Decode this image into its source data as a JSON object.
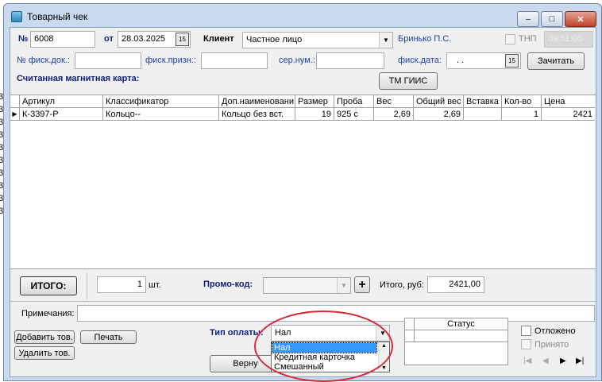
{
  "background_row_labels": [
    "3",
    "3",
    "3",
    "3",
    "3",
    "3",
    "3",
    "3",
    "3",
    "3"
  ],
  "window": {
    "title": "Товарный чек",
    "controls": {
      "minimize": "‒",
      "maximize": "□",
      "close": "✕"
    }
  },
  "header": {
    "number_label": "№",
    "number_value": "6008",
    "date_label": "от",
    "date_value": "28.03.2025",
    "calendar_button": "15",
    "client_label": "Клиент",
    "client_value": "Частное лицо",
    "client_person": "Бринько П.С.",
    "tnp_label": "ТНП",
    "tnp_value": "09:51:00",
    "fisc_doc_label": "№ фиск.док.:",
    "fisc_doc_value": "",
    "fisc_sign_label": "фиск.призн.:",
    "fisc_sign_value": "",
    "serial_label": "сер.нум.:",
    "serial_value": "",
    "fisc_date_label": "фиск.дата:",
    "fisc_date_value": ". .",
    "read_button": "Зачитать",
    "magnetic_card_label": "Считанная магнитная карта:",
    "tm_giis_button": "ТМ ГИИС"
  },
  "table": {
    "columns": [
      "Артикул",
      "Классификатор",
      "Доп.наименовани",
      "Размер",
      "Проба",
      "Вес",
      "Общий вес",
      "Вставка",
      "Кол-во",
      "Цена"
    ],
    "rows": [
      {
        "article": "К-3397-Р",
        "classifier": "Кольцо--",
        "extra_name": "Кольцо без вст.",
        "size": "19",
        "probe": "925 с",
        "weight": "2,69",
        "total_weight": "2,69",
        "insert": "",
        "qty": "1",
        "price": "2421"
      }
    ]
  },
  "totals": {
    "total_button": "ИТОГО:",
    "qty_value": "1",
    "qty_unit": "шт.",
    "promo_label": "Промо-код:",
    "promo_value": "",
    "promo_add": "+",
    "sum_label": "Итого, руб:",
    "sum_value": "2421,00"
  },
  "footer": {
    "notes_label": "Примечания:",
    "notes_value": "",
    "add_item_button": "Добавить тов.",
    "delete_item_button": "Удалить тов.",
    "print_button": "Печать",
    "payment_label": "Тип оплаты:",
    "payment_value": "Нал",
    "payment_options": [
      "Нал",
      "Кредитная карточка",
      "Смешанный"
    ],
    "return_button": "Верну",
    "status_header": "Статус",
    "deferred_label": "Отложено",
    "accepted_label": "Принято"
  },
  "colors": {
    "window_frame": "#c9d9ee",
    "client_bg": "#f0f0f0",
    "highlight_oval": "#d62838",
    "selection": "#3399ff",
    "label_blue": "#1a3fb0"
  }
}
